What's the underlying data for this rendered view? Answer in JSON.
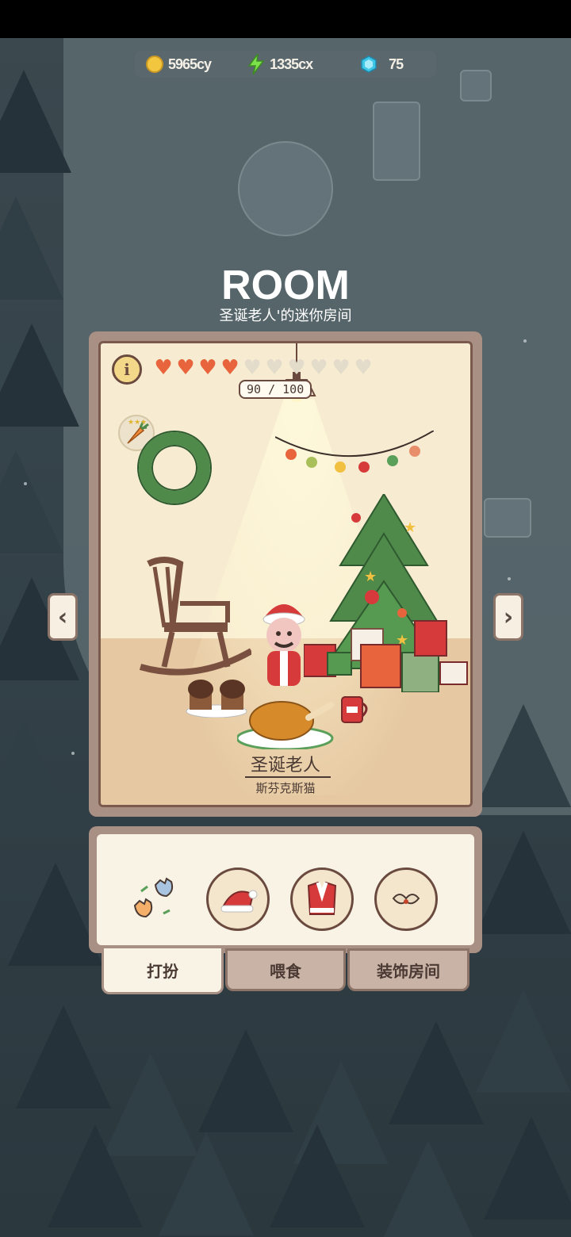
{
  "currency": {
    "coins": {
      "icon": "coin-icon",
      "value": "5965cy"
    },
    "energy": {
      "icon": "lightning-icon",
      "value": "1335cx"
    },
    "gems": {
      "icon": "gem-icon",
      "value": "75"
    }
  },
  "room": {
    "title": "ROOM",
    "subtitle": "圣诞老人'的迷你房间"
  },
  "pet": {
    "name": "圣诞老人",
    "breed": "斯芬克斯猫",
    "hearts_total": 10,
    "hearts_full": 4,
    "affection_text": "90 / 100"
  },
  "actions": {
    "swap_icon": "swap-cats-icon",
    "slots": [
      "santa-hat-icon",
      "santa-outfit-icon",
      "mustache-icon"
    ]
  },
  "tabs": [
    {
      "label": "打扮",
      "active": true
    },
    {
      "label": "喂食",
      "active": false
    },
    {
      "label": "装饰房间",
      "active": false
    }
  ],
  "colors": {
    "heart_full": "#e8643c",
    "panel_frame": "#a89084",
    "room_wall": "#f7ecd1"
  }
}
